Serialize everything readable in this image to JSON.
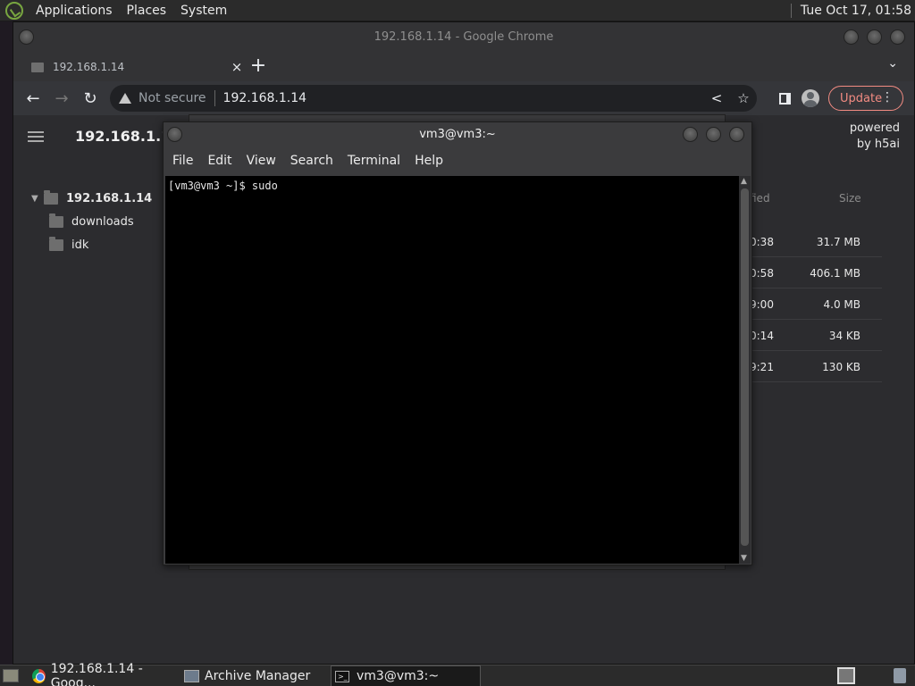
{
  "panel": {
    "menus": [
      "Applications",
      "Places",
      "System"
    ],
    "clock": "Tue Oct 17, 01:58"
  },
  "chrome": {
    "window_title": "192.168.1.14 - Google Chrome",
    "tab_title": "192.168.1.14",
    "tab_close": "×",
    "new_tab": "+",
    "tab_search": "⌄",
    "security_label": "Not secure",
    "url": "192.168.1.14",
    "update_label": "Update"
  },
  "page": {
    "host": "192.168.1.14",
    "powered_line1": "powered",
    "powered_line2": "by h5ai",
    "tree": {
      "root": "192.168.1.14",
      "children": [
        "downloads",
        "idk"
      ]
    },
    "columns": {
      "modified": "fied",
      "size": "Size"
    },
    "files": [
      {
        "modified": "0:38",
        "size": "31.7 MB"
      },
      {
        "modified": "0:58",
        "size": "406.1 MB"
      },
      {
        "modified": "9:00",
        "size": "4.0 MB"
      },
      {
        "modified": "0:14",
        "size": "34 KB"
      },
      {
        "modified": "9:21",
        "size": "130 KB"
      }
    ]
  },
  "terminal": {
    "title": "vm3@vm3:~",
    "menus": [
      "File",
      "Edit",
      "View",
      "Search",
      "Terminal",
      "Help"
    ],
    "line1": "[vm3@vm3 ~]$ sudo"
  },
  "taskbar": {
    "items": [
      "192.168.1.14 - Goog...",
      "Archive Manager",
      "vm3@vm3:~"
    ],
    "terminal_icon_glyph": ">_"
  },
  "colors": {
    "update_accent": "#f28b82",
    "terminal_bg": "#000000",
    "logo_green": "#78a640"
  }
}
